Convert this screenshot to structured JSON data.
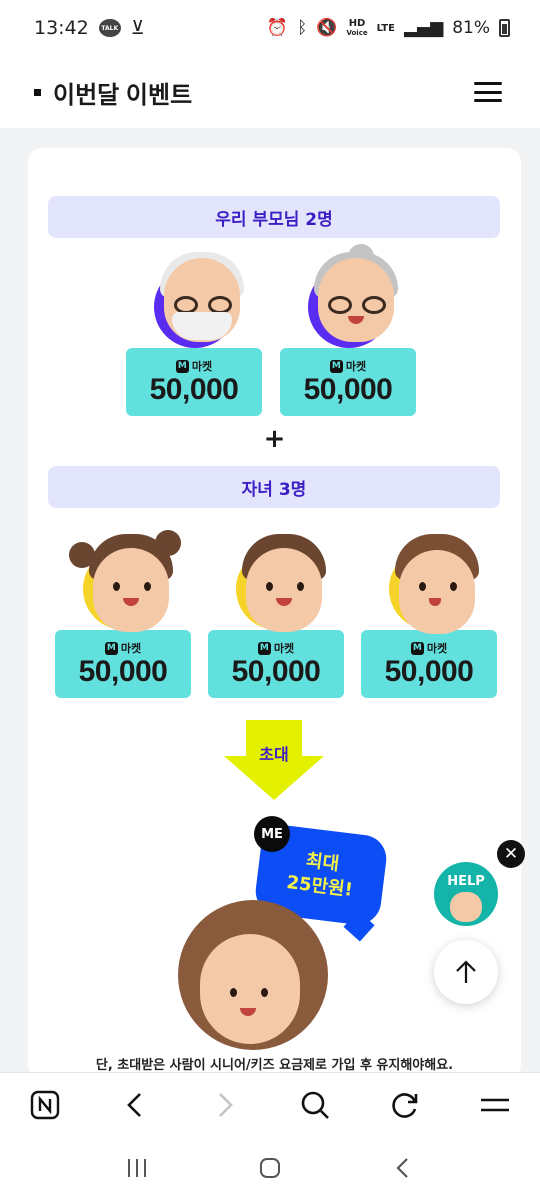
{
  "status_bar": {
    "time": "13:42",
    "talk_label": "TALK",
    "hd_label": "HD",
    "voice_label": "Voice",
    "lte_label": "LTE",
    "battery": "81%"
  },
  "header": {
    "title": "이번달 이벤트"
  },
  "event": {
    "parents_heading": "우리 부모님 2명",
    "children_heading": "자녀 3명",
    "plus": "+",
    "invite_label": "초대",
    "parents": [
      {
        "brand": "마켓",
        "amount": "50,000"
      },
      {
        "brand": "마켓",
        "amount": "50,000"
      }
    ],
    "children": [
      {
        "brand": "마켓",
        "amount": "50,000"
      },
      {
        "brand": "마켓",
        "amount": "50,000"
      },
      {
        "brand": "마켓",
        "amount": "50,000"
      }
    ],
    "me_badge": "ME",
    "bubble_line1": "최대",
    "bubble_line2": "25만원!",
    "notice": "단, 초대받은 사람이 시니어/키즈 요금제로 가입 후 유지해야해요."
  },
  "help_label": "HELP",
  "colors": {
    "purple": "#5a2cf2",
    "yellow": "#f6d329",
    "mint": "#62e0dd",
    "band": "#e3e5fd",
    "bubble": "#0c4df5",
    "arrow": "#e3f000"
  }
}
